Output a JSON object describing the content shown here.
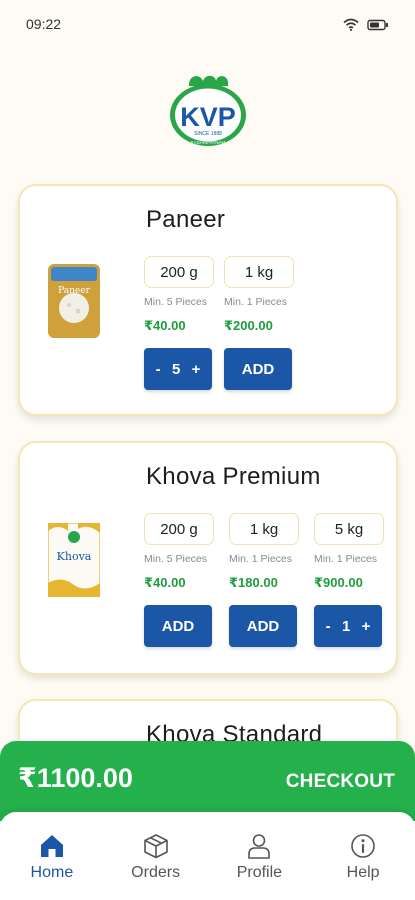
{
  "status_bar": {
    "time": "09:22"
  },
  "brand": {
    "logo_text": "KVP",
    "logo_sub": "SINCE 1988",
    "logo_ring": "KASARIPATNAM"
  },
  "products": [
    {
      "name": "Paneer",
      "package_label": "Paneer",
      "variants": [
        {
          "weight": "200 g",
          "min": "Min. 5 Pieces",
          "price": "₹40.00",
          "action": "stepper",
          "qty": "5"
        },
        {
          "weight": "1 kg",
          "min": "Min. 1 Pieces",
          "price": "₹200.00",
          "action": "add",
          "label": "ADD"
        }
      ]
    },
    {
      "name": "Khova Premium",
      "package_label": "Khova",
      "variants": [
        {
          "weight": "200 g",
          "min": "Min. 5 Pieces",
          "price": "₹40.00",
          "action": "add",
          "label": "ADD"
        },
        {
          "weight": "1 kg",
          "min": "Min. 1 Pieces",
          "price": "₹180.00",
          "action": "add",
          "label": "ADD"
        },
        {
          "weight": "5 kg",
          "min": "Min. 1 Pieces",
          "price": "₹900.00",
          "action": "stepper",
          "qty": "1"
        }
      ]
    },
    {
      "name": "Khova Standard"
    }
  ],
  "stepper_symbols": {
    "minus": "-",
    "plus": "+"
  },
  "checkout": {
    "total": "₹1100.00",
    "button_label": "CHECKOUT"
  },
  "nav": {
    "items": [
      {
        "label": "Home",
        "icon": "home-icon",
        "active": true
      },
      {
        "label": "Orders",
        "icon": "box-icon",
        "active": false
      },
      {
        "label": "Profile",
        "icon": "user-icon",
        "active": false
      },
      {
        "label": "Help",
        "icon": "info-icon",
        "active": false
      }
    ]
  },
  "colors": {
    "accent_blue": "#1b57a6",
    "checkout_green": "#24b04b",
    "price_green": "#1e9e3e",
    "card_border": "#f6e6b4",
    "background": "#fdfbf4"
  }
}
